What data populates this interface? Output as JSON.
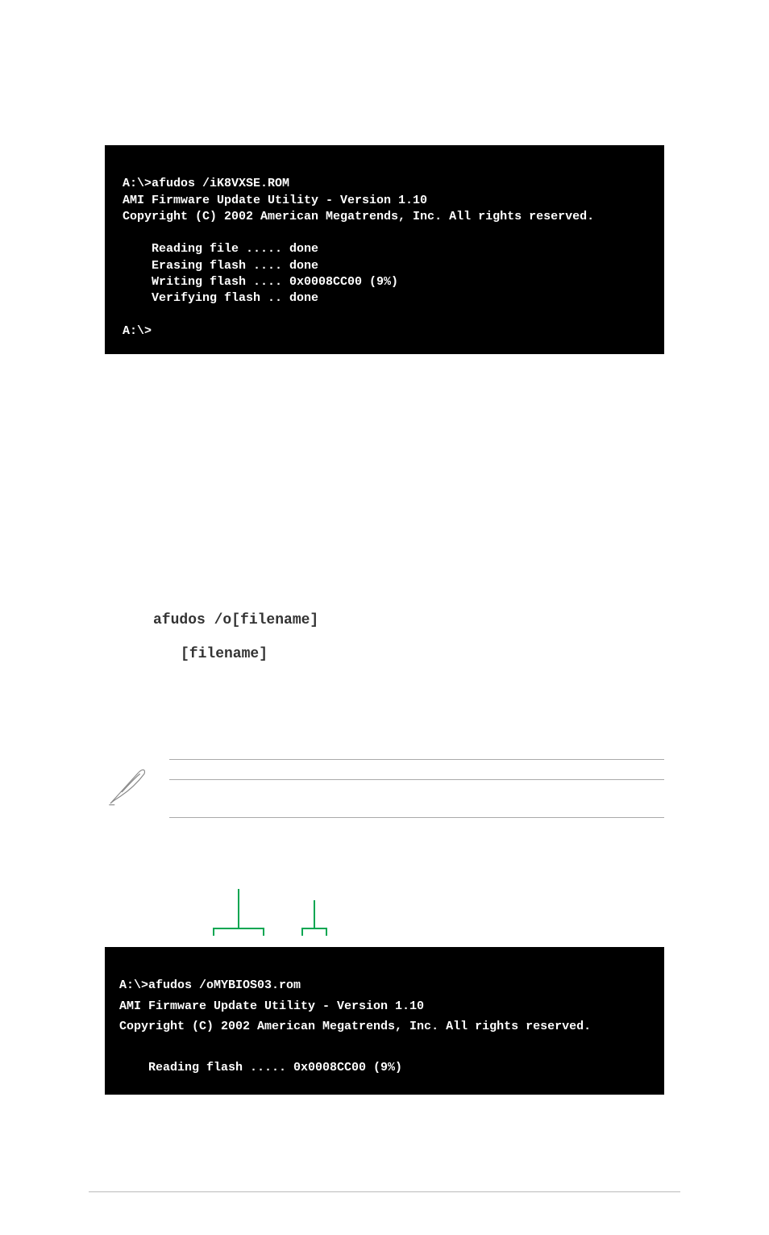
{
  "terminal1": {
    "line1": "A:\\>afudos /iK8VXSE.ROM",
    "line2": "AMI Firmware Update Utility - Version 1.10",
    "line3": "Copyright (C) 2002 American Megatrends, Inc. All rights reserved.",
    "blank": "",
    "line4": "    Reading file ..... done",
    "line5": "    Erasing flash .... done",
    "line6": "    Writing flash .... 0x0008CC00 (9%)",
    "line7": "    Verifying flash .. done",
    "line8": "A:\\>"
  },
  "syntax": {
    "line1": "afudos /o[filename]",
    "line2": "[filename]"
  },
  "terminal2": {
    "line1": "A:\\>afudos /oMYBIOS03.rom",
    "line2": "AMI Firmware Update Utility - Version 1.10",
    "line3": "Copyright (C) 2002 American Megatrends, Inc. All rights reserved.",
    "blank": "",
    "line4": "    Reading flash ..... 0x0008CC00 (9%)"
  }
}
